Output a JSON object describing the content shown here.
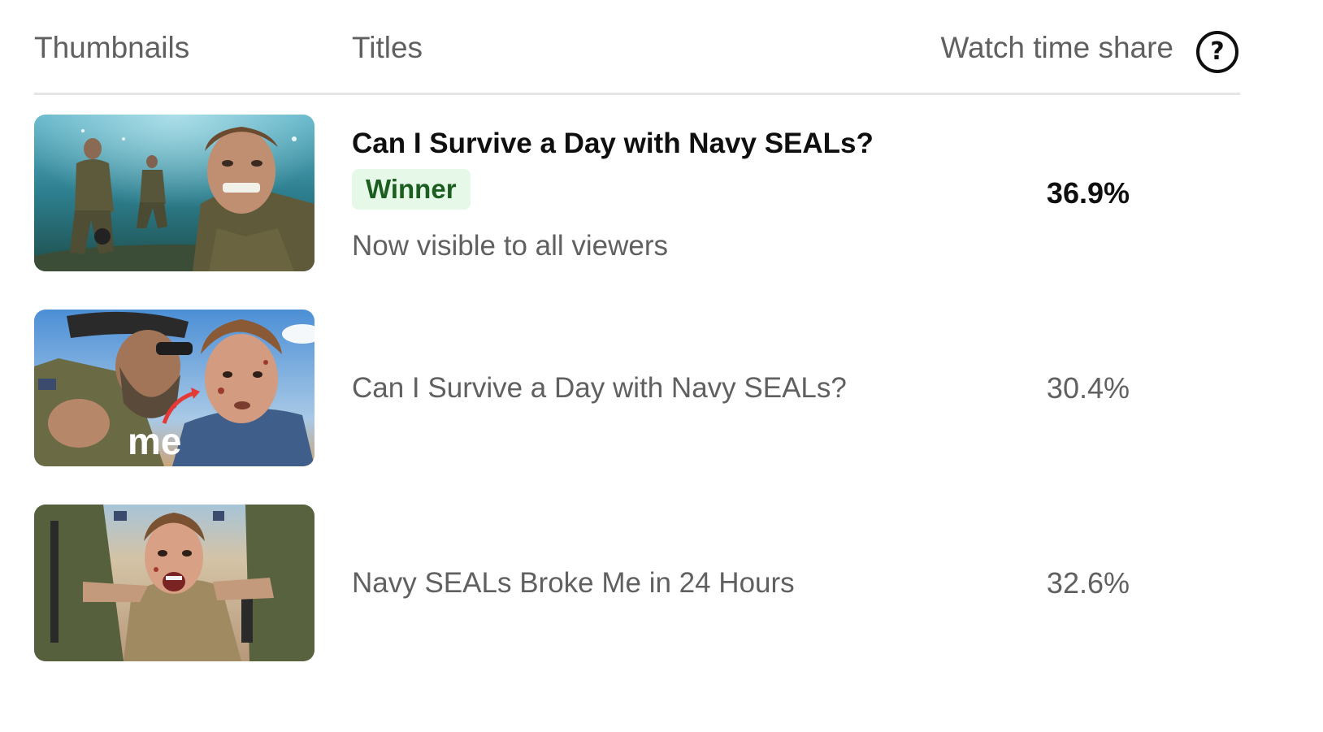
{
  "header": {
    "thumbnails": "Thumbnails",
    "titles": "Titles",
    "watch_time_share": "Watch time share",
    "help_icon": "help-circle-icon"
  },
  "rows": [
    {
      "title": "Can I Survive a Day with Navy SEALs?",
      "badge": "Winner",
      "status": "Now visible to all viewers",
      "share": "36.9%",
      "winner": true
    },
    {
      "title": "Can I Survive a Day with Navy SEALs?",
      "thumbnail_text": "me",
      "share": "30.4%",
      "winner": false
    },
    {
      "title": "Navy SEALs Broke Me in 24 Hours",
      "share": "32.6%",
      "winner": false
    }
  ],
  "colors": {
    "badge_bg": "#e6f9e8",
    "badge_text": "#1b5e20",
    "muted_text": "#606060",
    "primary_text": "#0f0f0f"
  }
}
